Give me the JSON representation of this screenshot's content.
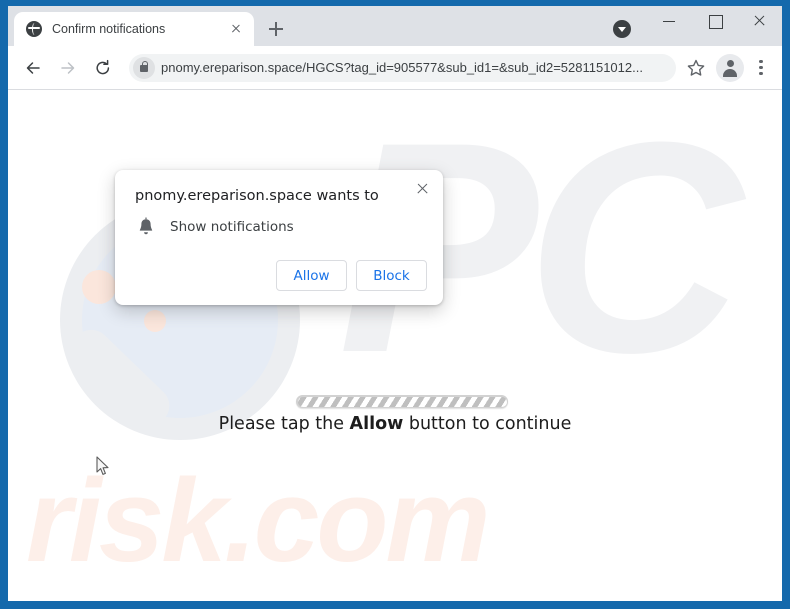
{
  "window": {
    "controls": {
      "minimize": "minimize",
      "maximize": "maximize",
      "close": "close"
    }
  },
  "tabstrip": {
    "tab": {
      "title": "Confirm notifications",
      "favicon": "globe-icon",
      "close_label": "close-tab"
    },
    "new_tab_label": "new-tab",
    "dropdown_label": "tab-search-dropdown"
  },
  "toolbar": {
    "back_label": "back",
    "forward_label": "forward",
    "reload_label": "reload",
    "url": "pnomy.ereparison.space/HGCS?tag_id=905577&sub_id1=&sub_id2=5281151012...",
    "lock_icon": "lock-icon",
    "star_label": "bookmark",
    "avatar_label": "profile",
    "menu_label": "chrome-menu"
  },
  "page": {
    "watermark_pc": "PC",
    "watermark_risk": "risk.com",
    "tap_prefix": "Please tap the ",
    "tap_bold": "Allow",
    "tap_suffix": " button to continue",
    "progress_value": 100
  },
  "dialog": {
    "title": "pnomy.ereparison.space wants to",
    "option_icon": "bell-icon",
    "option_label": "Show notifications",
    "allow_label": "Allow",
    "block_label": "Block",
    "close_label": "close-dialog",
    "accent_color": "#1a73e8"
  }
}
